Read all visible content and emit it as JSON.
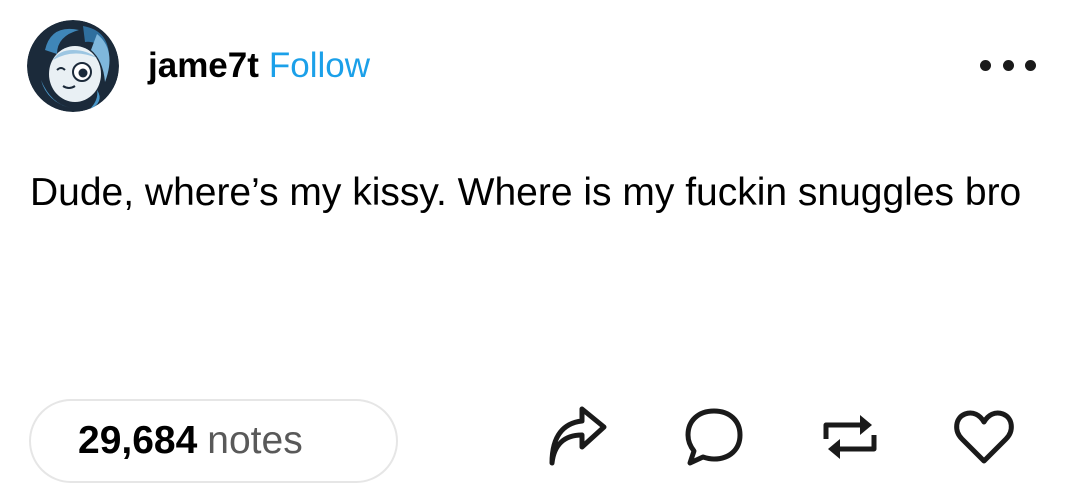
{
  "post": {
    "username": "jame7t",
    "follow_label": "Follow",
    "body": "Dude, where’s my kissy. Where is my fuckin snuggles bro",
    "notes_count": "29,684",
    "notes_label": "notes"
  },
  "icons": {
    "more": "more-options-icon",
    "share": "share-icon",
    "reply": "reply-icon",
    "reblog": "reblog-icon",
    "like": "heart-icon"
  },
  "colors": {
    "follow": "#1ba0e9",
    "text": "#000000",
    "notes_label": "#595959",
    "pill_border": "#e6e6e6",
    "icon": "#1a1a1a"
  }
}
